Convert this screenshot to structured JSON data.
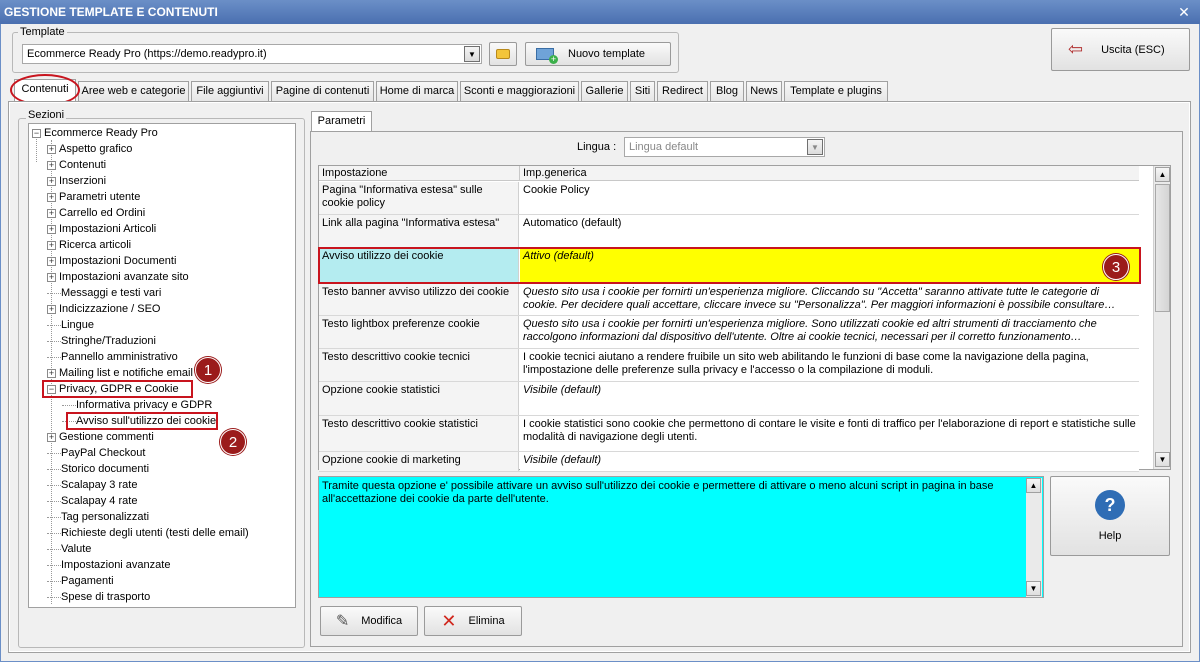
{
  "window": {
    "title": "GESTIONE TEMPLATE E CONTENUTI",
    "close_icon": "✕"
  },
  "template_group": {
    "label": "Template",
    "selected": "Ecommerce Ready Pro (https://demo.readypro.it)",
    "new_template_label": "Nuovo template",
    "exit_label": "Uscita (ESC)"
  },
  "tabs": [
    {
      "label": "Contenuti"
    },
    {
      "label": "Aree web e categorie"
    },
    {
      "label": "File aggiuntivi"
    },
    {
      "label": "Pagine di contenuti"
    },
    {
      "label": "Home di marca"
    },
    {
      "label": "Sconti e maggiorazioni"
    },
    {
      "label": "Gallerie"
    },
    {
      "label": "Siti"
    },
    {
      "label": "Redirect"
    },
    {
      "label": "Blog"
    },
    {
      "label": "News"
    },
    {
      "label": "Template e plugins"
    }
  ],
  "sections": {
    "label": "Sezioni",
    "root": "Ecommerce Ready Pro",
    "items": [
      {
        "label": "Aspetto grafico",
        "exp": "+"
      },
      {
        "label": "Contenuti",
        "exp": "+"
      },
      {
        "label": "Inserzioni",
        "exp": "+"
      },
      {
        "label": "Parametri utente",
        "exp": "+"
      },
      {
        "label": "Carrello ed Ordini",
        "exp": "+"
      },
      {
        "label": "Impostazioni Articoli",
        "exp": "+"
      },
      {
        "label": "Ricerca articoli",
        "exp": "+"
      },
      {
        "label": "Impostazioni Documenti",
        "exp": "+"
      },
      {
        "label": "Impostazioni avanzate sito",
        "exp": "+"
      },
      {
        "label": "Messaggi e testi vari",
        "exp": ""
      },
      {
        "label": "Indicizzazione / SEO",
        "exp": "+"
      },
      {
        "label": "Lingue",
        "exp": ""
      },
      {
        "label": "Stringhe/Traduzioni",
        "exp": ""
      },
      {
        "label": "Pannello amministrativo",
        "exp": ""
      },
      {
        "label": "Mailing list e notifiche email",
        "exp": "+"
      },
      {
        "label": "Privacy, GDPR e Cookie",
        "exp": "-"
      },
      {
        "label": "Informativa privacy e GDPR",
        "exp": "",
        "child": true
      },
      {
        "label": "Avviso sull'utilizzo dei cookie",
        "exp": "",
        "child": true
      },
      {
        "label": "Gestione commenti",
        "exp": "+"
      },
      {
        "label": "PayPal Checkout",
        "exp": ""
      },
      {
        "label": "Storico documenti",
        "exp": ""
      },
      {
        "label": "Scalapay 3 rate",
        "exp": ""
      },
      {
        "label": "Scalapay 4 rate",
        "exp": ""
      },
      {
        "label": "Tag personalizzati",
        "exp": ""
      },
      {
        "label": "Richieste degli utenti (testi delle email)",
        "exp": ""
      },
      {
        "label": "Valute",
        "exp": ""
      },
      {
        "label": "Impostazioni avanzate",
        "exp": ""
      },
      {
        "label": "Pagamenti",
        "exp": ""
      },
      {
        "label": "Spese di trasporto",
        "exp": ""
      }
    ]
  },
  "params_tab": {
    "label": "Parametri"
  },
  "language": {
    "label": "Lingua :",
    "value": "Lingua default"
  },
  "grid": {
    "headers": [
      "Impostazione",
      "Imp.generica"
    ],
    "rows": [
      {
        "name": "Pagina \"Informativa estesa\" sulle cookie policy",
        "value": "Cookie Policy",
        "italic": false
      },
      {
        "name": "Link alla pagina \"Informativa estesa\"",
        "value": "Automatico (default)",
        "italic": false
      },
      {
        "name": "Avviso utilizzo dei cookie",
        "value": "Attivo (default)",
        "italic": true
      },
      {
        "name": "Testo banner avviso utilizzo dei cookie",
        "value": "Questo sito usa i cookie per fornirti un'esperienza migliore. Cliccando su \"Accetta\" saranno attivate tutte le categorie di cookie. Per decidere quali accettare, cliccare invece su \"Personalizza\". Per maggiori informazioni è possibile consultare…",
        "italic": true
      },
      {
        "name": "Testo lightbox preferenze cookie",
        "value": "Questo sito usa i cookie per fornirti un'esperienza migliore. Sono utilizzati cookie ed altri strumenti di tracciamento che raccolgono informazioni dal dispositivo dell'utente. Oltre ai cookie tecnici, necessari per il corretto funzionamento…",
        "italic": true
      },
      {
        "name": "Testo descrittivo cookie tecnici",
        "value": "I cookie tecnici aiutano a rendere fruibile un sito web abilitando le funzioni di base come la navigazione della pagina, l'impostazione delle preferenze sulla privacy e l'accesso o la compilazione di moduli.",
        "italic": false
      },
      {
        "name": "Opzione cookie statistici",
        "value": "Visibile (default)",
        "italic": true
      },
      {
        "name": "Testo descrittivo cookie statistici",
        "value": "I cookie statistici sono cookie che permettono di contare le visite e fonti di traffico per l'elaborazione di report e statistiche sulle modalità di navigazione degli utenti.",
        "italic": false
      },
      {
        "name": "Opzione cookie di marketing",
        "value": "Visibile (default)",
        "italic": true
      }
    ]
  },
  "description": "Tramite questa opzione e' possibile attivare un avviso sull'utilizzo dei cookie e permettere di attivare o meno alcuni script in pagina in base all'accettazione dei cookie da parte dell'utente.",
  "buttons": {
    "help": "Help",
    "help_icon": "?",
    "edit": "Modifica",
    "delete": "Elimina"
  },
  "callouts": [
    "1",
    "2",
    "3"
  ],
  "colors": {
    "highlight_row": "#ffff00",
    "highlight_name": "#b4ecf0",
    "description_bg": "#00ffff",
    "callout": "#9b1b1b",
    "annotation": "#c8141e"
  }
}
